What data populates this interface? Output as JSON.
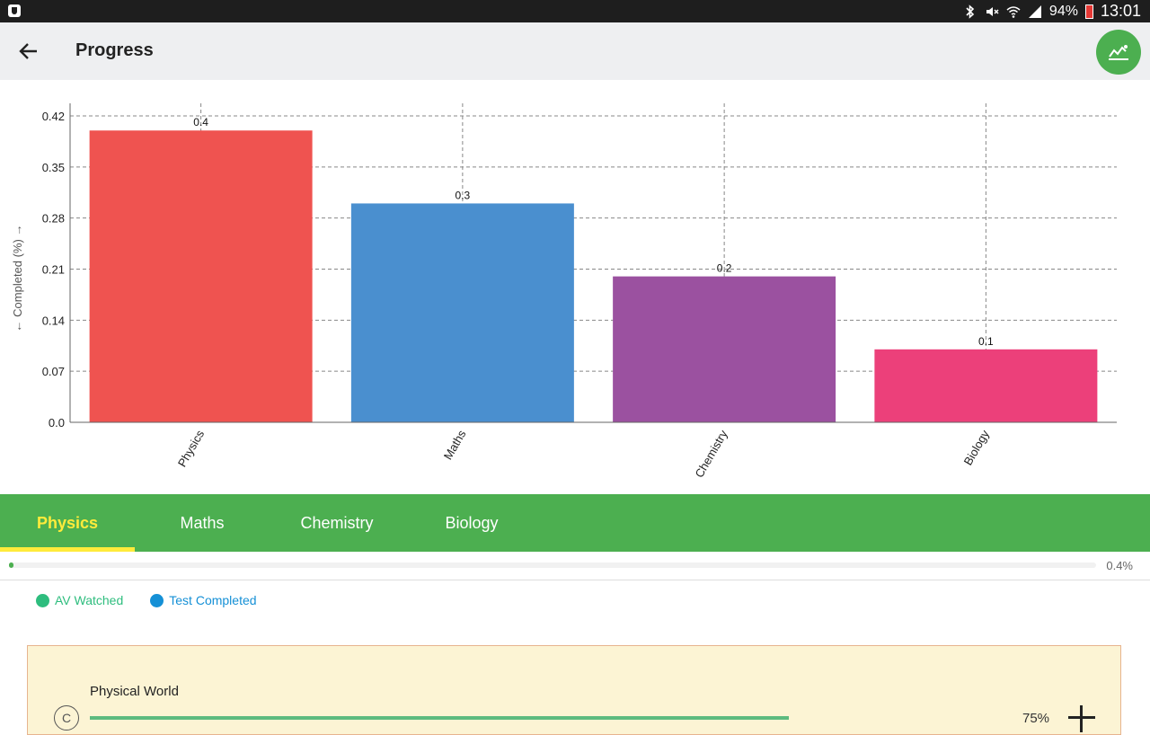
{
  "status_bar": {
    "battery": "94%",
    "time": "13:01",
    "icons": [
      "shield-icon",
      "bluetooth-icon",
      "mute-icon",
      "wifi-icon",
      "signal-icon",
      "battery-icon"
    ]
  },
  "app_bar": {
    "title": "Progress",
    "back_icon": "arrow-left-icon",
    "action_icon": "trend-chart-icon",
    "accent_color": "#4caf50"
  },
  "chart_data": {
    "type": "bar",
    "categories": [
      "Physics",
      "Maths",
      "Chemistry",
      "Biology"
    ],
    "values": [
      0.4,
      0.3,
      0.2,
      0.1
    ],
    "value_labels": [
      "0.4",
      "0.3",
      "0.2",
      "0.1"
    ],
    "colors": [
      "#ef5350",
      "#4a8fcf",
      "#9b51a0",
      "#ec407a"
    ],
    "ylabel": "← Completed (%) →",
    "xlabel": "",
    "ylim": [
      0,
      0.42
    ],
    "yticks": [
      "0.0",
      "0.07",
      "0.14",
      "0.21",
      "0.28",
      "0.35",
      "0.42"
    ],
    "grid": true
  },
  "tabs": {
    "items": [
      {
        "label": "Physics",
        "active": true
      },
      {
        "label": "Maths",
        "active": false
      },
      {
        "label": "Chemistry",
        "active": false
      },
      {
        "label": "Biology",
        "active": false
      }
    ],
    "indicator_color": "#ffeb3b"
  },
  "overall_progress": {
    "value": 0.4,
    "label": "0.4%"
  },
  "legend": {
    "av_watched": {
      "label": "AV Watched",
      "color": "#2ebd7e"
    },
    "test_completed": {
      "label": "Test Completed",
      "color": "#1590d6"
    }
  },
  "chapter": {
    "title": "Physical World",
    "badge": "C",
    "percent_label": "75%",
    "progress": 0.75
  }
}
